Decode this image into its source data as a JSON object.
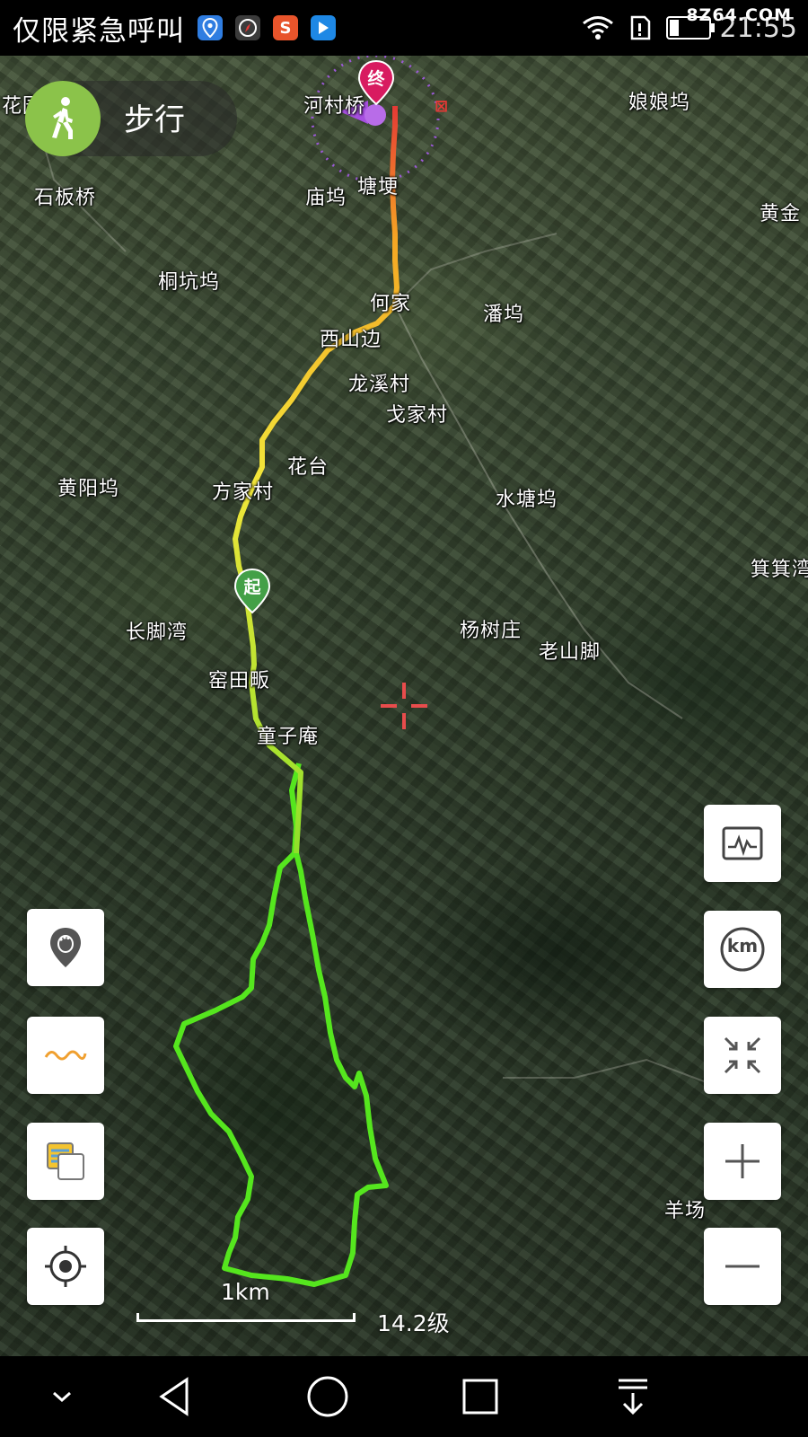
{
  "status_bar": {
    "emergency_text": "仅限紧急呼叫",
    "app_icons": [
      {
        "name": "map-pin-app-icon",
        "color": "#2f7de1",
        "glyph": "⚲"
      },
      {
        "name": "compass-app-icon",
        "color": "#444444",
        "glyph": "◆"
      },
      {
        "name": "s-app-icon",
        "color": "#e8542b",
        "glyph": "S"
      },
      {
        "name": "play-app-icon",
        "color": "#1e88e5",
        "glyph": "▶"
      }
    ],
    "clock": "21:55",
    "watermark": "8Z64.COM"
  },
  "mode": {
    "label": "步行",
    "icon": "walking-person-icon",
    "accent_color": "#8bc34a"
  },
  "places": [
    {
      "id": "huayuan",
      "text": "花园"
    },
    {
      "id": "hecunqiao",
      "text": "河村桥"
    },
    {
      "id": "niangniangwu",
      "text": "娘娘坞"
    },
    {
      "id": "shibanqiao",
      "text": "石板桥"
    },
    {
      "id": "miaowu",
      "text": "庙坞"
    },
    {
      "id": "tangge",
      "text": "塘埂"
    },
    {
      "id": "huangjin",
      "text": "黄金"
    },
    {
      "id": "tongkengwu",
      "text": "桐坑坞"
    },
    {
      "id": "hejia",
      "text": "何家"
    },
    {
      "id": "panwu",
      "text": "潘坞"
    },
    {
      "id": "xishanbian",
      "text": "西山边"
    },
    {
      "id": "longxicun",
      "text": "龙溪村"
    },
    {
      "id": "gejiacun",
      "text": "戈家村"
    },
    {
      "id": "huatai",
      "text": "花台"
    },
    {
      "id": "huangyangwu",
      "text": "黄阳坞"
    },
    {
      "id": "fangjiacun",
      "text": "方家村"
    },
    {
      "id": "shuitangwu",
      "text": "水塘坞"
    },
    {
      "id": "kuojiwan",
      "text": "箕箕湾"
    },
    {
      "id": "changjiaowan",
      "text": "长脚湾"
    },
    {
      "id": "yangshuzhuang",
      "text": "杨树庄"
    },
    {
      "id": "laoshanjiao",
      "text": "老山脚"
    },
    {
      "id": "yaotianfan",
      "text": "窑田畈"
    },
    {
      "id": "tongziyan",
      "text": "童子庵"
    },
    {
      "id": "yangchang",
      "text": "羊场"
    }
  ],
  "markers": {
    "start_label": "起",
    "end_label": "终",
    "start_color": "#43a047",
    "end_color": "#d81b60"
  },
  "track_colors": {
    "loop": "#55e61e",
    "gradient_start": "#8ee02a",
    "gradient_mid": "#f2e63a",
    "gradient_end": "#e53935"
  },
  "scale": {
    "distance_label": "1km",
    "zoom_label": "14.2级"
  },
  "left_buttons": [
    {
      "name": "footprint-marker-button",
      "icon": "footprint-pin-icon"
    },
    {
      "name": "track-line-button",
      "icon": "wave-line-icon"
    },
    {
      "name": "map-layers-button",
      "icon": "layers-icon"
    },
    {
      "name": "locate-me-button",
      "icon": "crosshair-target-icon"
    }
  ],
  "right_buttons": [
    {
      "name": "elevation-chart-button",
      "icon": "pulse-chart-icon"
    },
    {
      "name": "km-markers-button",
      "icon": "km-icon",
      "label": "km"
    },
    {
      "name": "fit-track-button",
      "icon": "shrink-arrows-icon"
    },
    {
      "name": "zoom-in-button",
      "icon": "plus-icon"
    },
    {
      "name": "zoom-out-button",
      "icon": "minus-icon"
    }
  ],
  "nav_bar": {
    "buttons": [
      "collapse-down-icon",
      "back-triangle-icon",
      "home-circle-icon",
      "recents-square-icon",
      "notification-pull-icon"
    ]
  }
}
